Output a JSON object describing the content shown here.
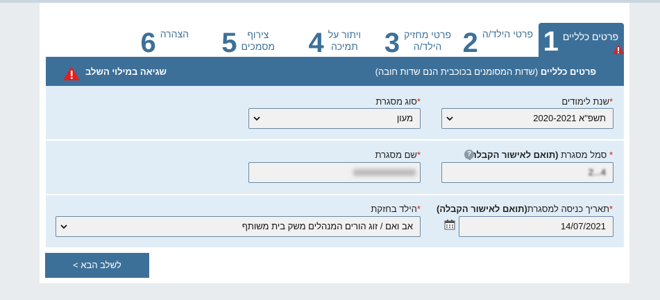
{
  "steps": [
    {
      "num": "1",
      "label": "פרטים כלליים"
    },
    {
      "num": "2",
      "label": "פרטי הילד/ה"
    },
    {
      "num": "3",
      "label_line1": "פרטי מחזיק",
      "label_line2": "הילד/ה"
    },
    {
      "num": "4",
      "label_line1": "ויתור על",
      "label_line2": "תמיכה"
    },
    {
      "num": "5",
      "label_line1": "צירוף",
      "label_line2": "מסמכים"
    },
    {
      "num": "6",
      "label": "הצהרה"
    }
  ],
  "section": {
    "title": "פרטים כלליים",
    "subtitle": "(שדות המסומנים בכוכבית הנם שדות חובה)",
    "error": "שגיאה במילוי השלב"
  },
  "form": {
    "school_year": {
      "label": "שנת לימודים",
      "value": "תשפ\"א 2020-2021"
    },
    "framework_type": {
      "label": "סוג מסגרת",
      "value": "מעון"
    },
    "framework_code": {
      "label": "סמל מסגרת ",
      "label_bold": "(תואם לאישור הקבלה)",
      "value": "4...2"
    },
    "framework_name": {
      "label": "שם מסגרת",
      "value": ""
    },
    "entry_date": {
      "label": "תאריך כניסה למסגרת",
      "label_bold": "(תואם לאישור הקבלה)",
      "value": "14/07/2021"
    },
    "custody": {
      "label": "הילד בחזקת",
      "value": "אב ואם / זוג הורים המנהלים משק בית משותף"
    }
  },
  "required_mark": "*",
  "help_icon": "?",
  "next_button": "לשלב הבא >",
  "colors": {
    "primary": "#3d7099",
    "row_bg": "#e1edf6",
    "required": "#dd1111",
    "warning": "#e02020"
  }
}
